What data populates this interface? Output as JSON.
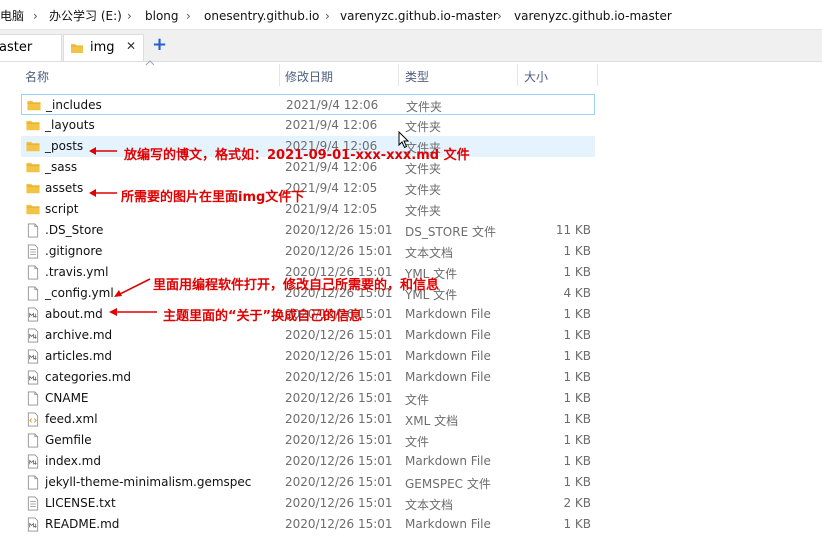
{
  "address_bar": {
    "crumbs": [
      "电脑",
      "办公学习 (E:)",
      "blong",
      "onesentry.github.io",
      "varenyzc.github.io-master",
      "varenyzc.github.io-master"
    ]
  },
  "tabs": [
    {
      "label": "aster"
    },
    {
      "label": "img",
      "close": "✕"
    }
  ],
  "tab_add": "+",
  "columns": {
    "name": "名称",
    "date": "修改日期",
    "type": "类型",
    "size": "大小"
  },
  "files": [
    {
      "name": "_includes",
      "date": "2021/9/4 12:06",
      "type": "文件夹",
      "size": "",
      "icon": "folder"
    },
    {
      "name": "_layouts",
      "date": "2021/9/4 12:06",
      "type": "文件夹",
      "size": "",
      "icon": "folder"
    },
    {
      "name": "_posts",
      "date": "2021/9/4 12:06",
      "type": "文件夹",
      "size": "",
      "icon": "folder"
    },
    {
      "name": "_sass",
      "date": "2021/9/4 12:06",
      "type": "文件夹",
      "size": "",
      "icon": "folder"
    },
    {
      "name": "assets",
      "date": "2021/9/4 12:05",
      "type": "文件夹",
      "size": "",
      "icon": "folder"
    },
    {
      "name": "script",
      "date": "2021/9/4 12:05",
      "type": "文件夹",
      "size": "",
      "icon": "folder"
    },
    {
      "name": ".DS_Store",
      "date": "2020/12/26 15:01",
      "type": "DS_STORE 文件",
      "size": "11 KB",
      "icon": "file"
    },
    {
      "name": ".gitignore",
      "date": "2020/12/26 15:01",
      "type": "文本文档",
      "size": "1 KB",
      "icon": "text"
    },
    {
      "name": ".travis.yml",
      "date": "2020/12/26 15:01",
      "type": "YML 文件",
      "size": "1 KB",
      "icon": "file"
    },
    {
      "name": "_config.yml",
      "date": "2020/12/26 15:01",
      "type": "YML 文件",
      "size": "4 KB",
      "icon": "file"
    },
    {
      "name": "about.md",
      "date": "2020/12/26 15:01",
      "type": "Markdown File",
      "size": "1 KB",
      "icon": "md"
    },
    {
      "name": "archive.md",
      "date": "2020/12/26 15:01",
      "type": "Markdown File",
      "size": "1 KB",
      "icon": "md"
    },
    {
      "name": "articles.md",
      "date": "2020/12/26 15:01",
      "type": "Markdown File",
      "size": "1 KB",
      "icon": "md"
    },
    {
      "name": "categories.md",
      "date": "2020/12/26 15:01",
      "type": "Markdown File",
      "size": "1 KB",
      "icon": "md"
    },
    {
      "name": "CNAME",
      "date": "2020/12/26 15:01",
      "type": "文件",
      "size": "1 KB",
      "icon": "file"
    },
    {
      "name": "feed.xml",
      "date": "2020/12/26 15:01",
      "type": "XML 文档",
      "size": "1 KB",
      "icon": "xml"
    },
    {
      "name": "Gemfile",
      "date": "2020/12/26 15:01",
      "type": "文件",
      "size": "1 KB",
      "icon": "file"
    },
    {
      "name": "index.md",
      "date": "2020/12/26 15:01",
      "type": "Markdown File",
      "size": "1 KB",
      "icon": "md"
    },
    {
      "name": "jekyll-theme-minimalism.gemspec",
      "date": "2020/12/26 15:01",
      "type": "GEMSPEC 文件",
      "size": "1 KB",
      "icon": "file"
    },
    {
      "name": "LICENSE.txt",
      "date": "2020/12/26 15:01",
      "type": "文本文档",
      "size": "2 KB",
      "icon": "text"
    },
    {
      "name": "README.md",
      "date": "2020/12/26 15:01",
      "type": "Markdown File",
      "size": "1 KB",
      "icon": "md"
    }
  ],
  "annotations": [
    {
      "text": "放编写的博文，格式如：2021-09-01-xxx-xxx.md 文件"
    },
    {
      "text": "所需要的图片在里面img文件下"
    },
    {
      "text": "里面用编程软件打开，修改自己所需要的，和信息"
    },
    {
      "text": "主题里面的“关于”换成自己的信息"
    }
  ],
  "colors": {
    "folder": "#f3c343",
    "annotation": "#e00000",
    "header_text": "#4d6082",
    "hover_row": "#e5f3ff",
    "focus_border": "#99d1ff"
  }
}
